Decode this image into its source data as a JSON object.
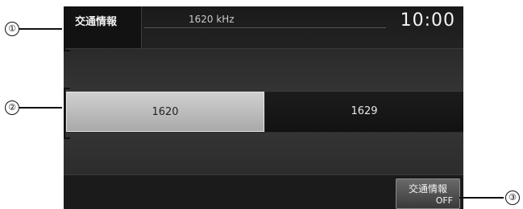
{
  "header": {
    "mode_label": "交通情報",
    "frequency": "1620 kHz",
    "clock": "10:00"
  },
  "presets": [
    {
      "label": "1620",
      "selected": true
    },
    {
      "label": "1629",
      "selected": false
    }
  ],
  "traffic_info_button": {
    "line1": "交通情報",
    "line2": "OFF"
  },
  "callouts": [
    "①",
    "②",
    "③"
  ]
}
